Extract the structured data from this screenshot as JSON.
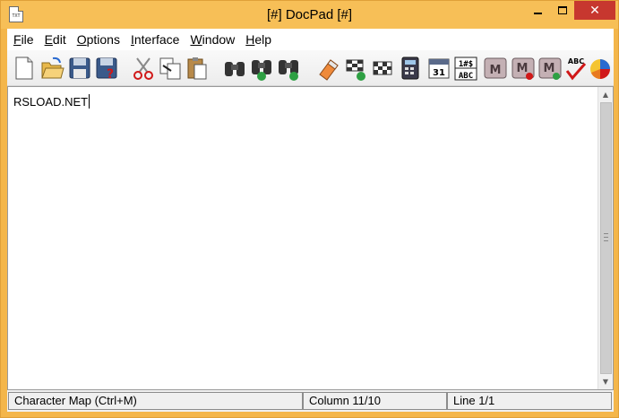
{
  "window": {
    "title": "[#] DocPad [#]",
    "icon_text": "TXT",
    "close_glyph": "✕"
  },
  "menu": [
    {
      "accel": "F",
      "rest": "ile"
    },
    {
      "accel": "E",
      "rest": "dit"
    },
    {
      "accel": "O",
      "rest": "ptions"
    },
    {
      "accel": "I",
      "rest": "nterface"
    },
    {
      "accel": "W",
      "rest": "indow"
    },
    {
      "accel": "H",
      "rest": "elp"
    }
  ],
  "toolbar": {
    "icons": [
      "new-document-icon",
      "open-folder-icon",
      "save-icon",
      "save-as-icon",
      "cut-icon",
      "copy-icon",
      "paste-icon",
      "find-icon",
      "find-next-icon",
      "replace-icon",
      "eraser-icon",
      "goto-flag-icon",
      "finish-flag-icon",
      "calculator-icon",
      "calendar-icon",
      "character-map-icon",
      "macro-icon",
      "macro-record-icon",
      "macro-play-icon",
      "spell-check-icon",
      "color-picker-icon"
    ],
    "calendar_day": "31",
    "charmap_top": "1#$",
    "charmap_bottom": "ABC",
    "macro_letter": "M",
    "spell_letters": "ABC"
  },
  "editor": {
    "content": "RSLOAD.NET"
  },
  "status": {
    "hint": "Character Map (Ctrl+M)",
    "column": "Column 11/10",
    "line": "Line 1/1"
  },
  "colors": {
    "frame": "#f7bf57",
    "close_button": "#c7372f"
  }
}
